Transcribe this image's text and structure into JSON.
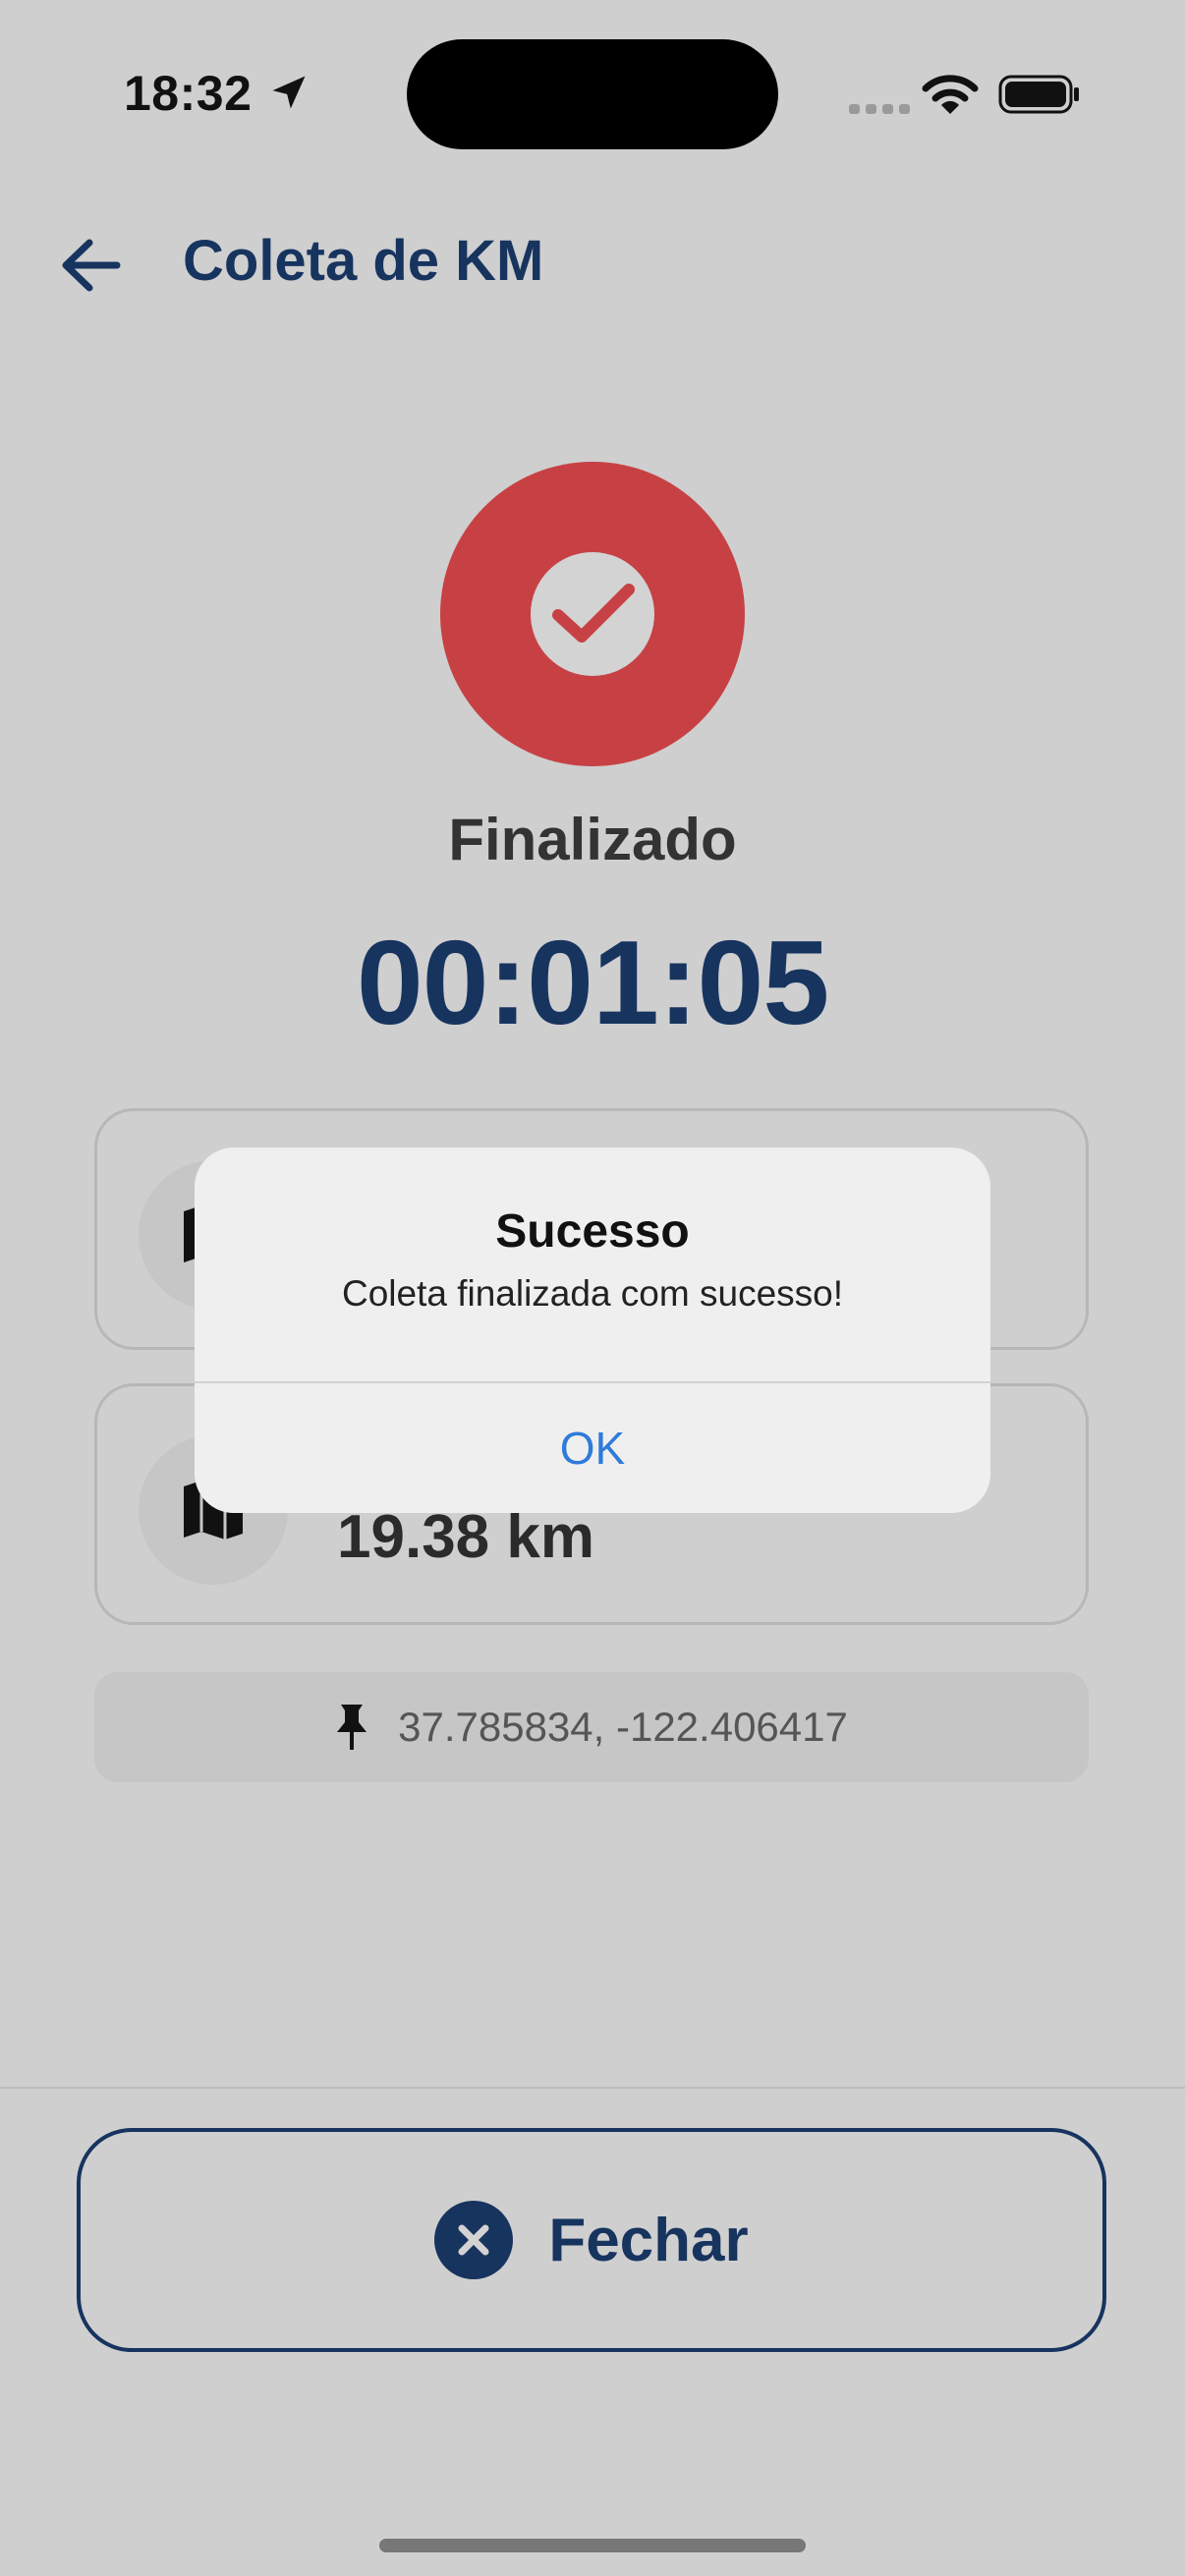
{
  "status_bar": {
    "time": "18:32",
    "icons": [
      "location-arrow-icon",
      "cellular-signal-icon",
      "wifi-icon",
      "battery-icon"
    ]
  },
  "header": {
    "back_icon": "arrow-left-icon",
    "title": "Coleta de KM"
  },
  "status": {
    "icon": "check-icon",
    "label": "Finalizado",
    "timer": "00:01:05"
  },
  "cards": [
    {
      "icon": "map-icon",
      "value": ""
    },
    {
      "icon": "map-icon",
      "value": "19.38 km"
    }
  ],
  "location": {
    "icon": "pin-icon",
    "coordinates": "37.785834, -122.406417"
  },
  "footer": {
    "close_icon": "close-circle-icon",
    "close_label": "Fechar"
  },
  "alert": {
    "title": "Sucesso",
    "message": "Coleta finalizada com sucesso!",
    "ok_label": "OK"
  },
  "colors": {
    "primary": "#17345f",
    "status_red": "#c74144",
    "link_blue": "#2f7bd8",
    "background_dimmed": "#cfcfcf"
  }
}
